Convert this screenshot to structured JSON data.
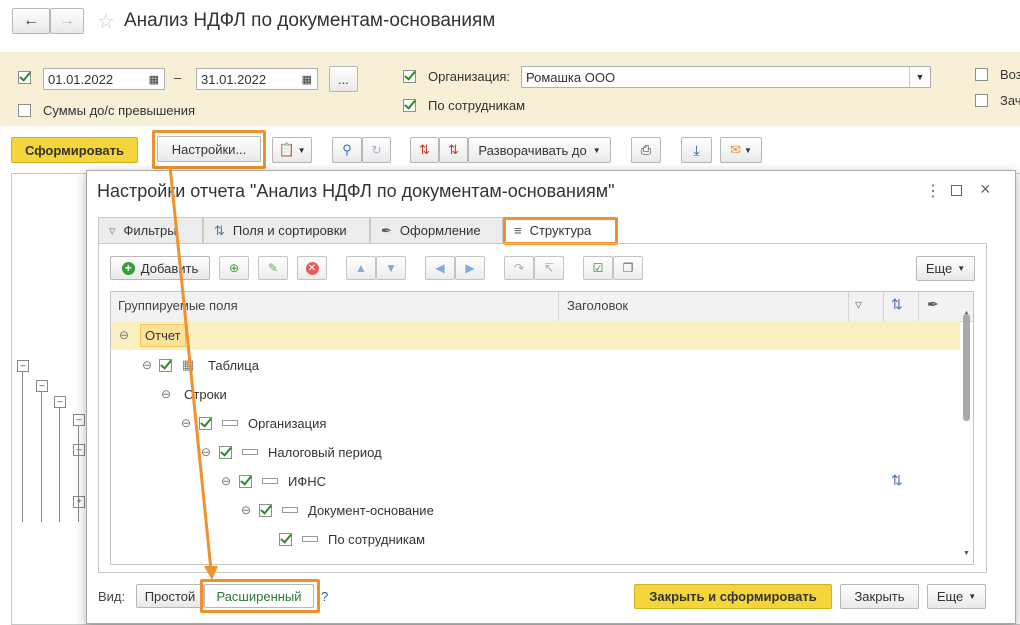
{
  "window": {
    "title": "Анализ НДФЛ по документам-основаниям"
  },
  "filters": {
    "date_from": "01.01.2022",
    "date_to": "31.01.2022",
    "dash": "–",
    "period_more": "...",
    "amounts_label": "Суммы до/с превышения",
    "org_label": "Организация:",
    "org_value": "Ромашка ООО",
    "by_employees_label": "По сотрудникам",
    "right_opt1": "Воз",
    "right_opt2": "Зач"
  },
  "toolbar": {
    "generate": "Сформировать",
    "settings": "Настройки...",
    "expand_to": "Разворачивать до"
  },
  "dialog": {
    "title": "Настройки отчета \"Анализ НДФЛ по документам-основаниям\"",
    "tabs": [
      {
        "label": "Фильтры",
        "icon": "filter-icon"
      },
      {
        "label": "Поля и сортировки",
        "icon": "sort-icon"
      },
      {
        "label": "Оформление",
        "icon": "brush-icon"
      },
      {
        "label": "Структура",
        "icon": "structure-icon"
      }
    ],
    "add": "Добавить",
    "more": "Еще",
    "columns": {
      "grouped_fields": "Группируемые поля",
      "header": "Заголовок"
    },
    "tree": [
      {
        "label": "Отчет",
        "level": 0,
        "checked": false
      },
      {
        "label": "Таблица",
        "level": 1,
        "checked": true
      },
      {
        "label": "Строки",
        "level": 2,
        "checked": false
      },
      {
        "label": "Организация",
        "level": 3,
        "checked": true
      },
      {
        "label": "Налоговый период",
        "level": 4,
        "checked": true
      },
      {
        "label": "ИФНС",
        "level": 5,
        "checked": true
      },
      {
        "label": "Документ-основание",
        "level": 6,
        "checked": true
      },
      {
        "label": "По сотрудникам",
        "level": 7,
        "checked": true
      }
    ],
    "view_label": "Вид:",
    "view_simple": "Простой",
    "view_extended": "Расширенный",
    "help": "?",
    "close_and_generate": "Закрыть и сформировать",
    "close": "Закрыть",
    "more_bottom": "Еще"
  },
  "colors": {
    "accent_yellow": "#f5d53c",
    "highlight_orange": "#f0922b",
    "check_green": "#2a8a2a"
  }
}
